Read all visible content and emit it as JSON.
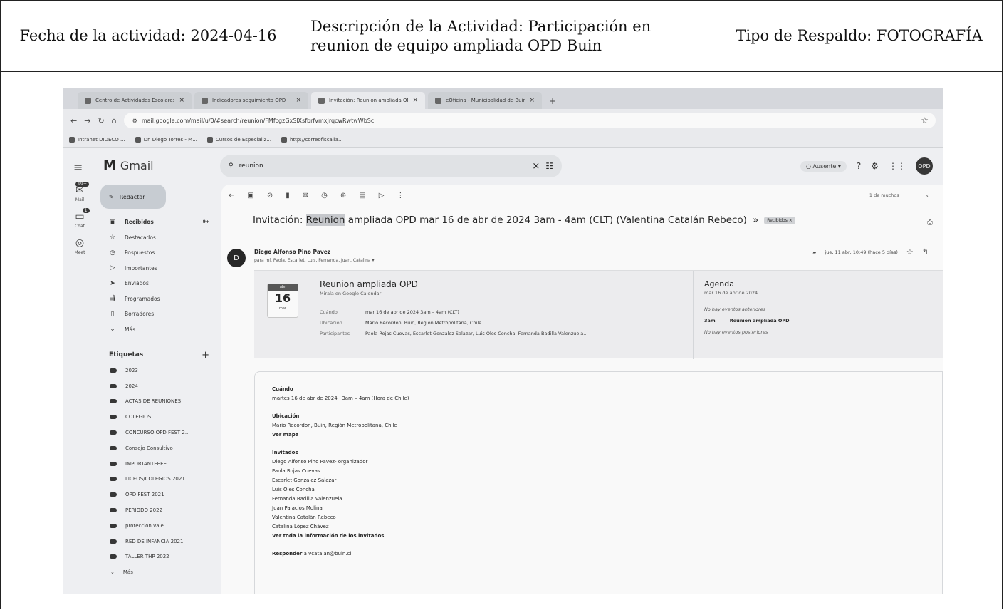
{
  "header": {
    "fecha": "Fecha de la actividad: 2024-04-16",
    "descripcion_l1": "Descripción de la Actividad: Participación en",
    "descripcion_l2": "reunion de equipo ampliada OPD Buin",
    "tipo": "Tipo de Respaldo: FOTOGRAFÍA"
  },
  "browser": {
    "tabs": [
      {
        "label": "Centro de Actividades Escolares",
        "active": false
      },
      {
        "label": "Indicadores seguimiento OPD",
        "active": false
      },
      {
        "label": "Invitación: Reunion ampliada OPD",
        "active": true
      },
      {
        "label": "eOficina - Municipalidad de Buin",
        "active": false
      }
    ],
    "new_tab": "+",
    "url": "mail.google.com/mail/u/0/#search/reunion/FMfcgzGxSlXsfbrfvmxJrqcwRwtwWbSc",
    "bookmarks": [
      "Intranet DIDECO ...",
      "Dr. Diego Torres - M...",
      "Cursos de Especializ...",
      "http://correofiscalia..."
    ]
  },
  "gmail": {
    "logo": "Gmail",
    "search_value": "reunion",
    "status": "Ausente",
    "avatar": "OPD",
    "rail": [
      {
        "label": "Mail",
        "badge": "99+"
      },
      {
        "label": "Chat",
        "badge": "1"
      },
      {
        "label": "Meet",
        "badge": ""
      }
    ],
    "compose": "Redactar",
    "nav": [
      {
        "label": "Recibidos",
        "count": "9+",
        "icon": "▣",
        "selected": true
      },
      {
        "label": "Destacados",
        "count": "",
        "icon": "☆",
        "selected": false
      },
      {
        "label": "Pospuestos",
        "count": "",
        "icon": "◷",
        "selected": false
      },
      {
        "label": "Importantes",
        "count": "",
        "icon": "▷",
        "selected": false
      },
      {
        "label": "Enviados",
        "count": "",
        "icon": "➤",
        "selected": false
      },
      {
        "label": "Programados",
        "count": "",
        "icon": "⇶",
        "selected": false
      },
      {
        "label": "Borradores",
        "count": "",
        "icon": "▯",
        "selected": false
      },
      {
        "label": "Más",
        "count": "",
        "icon": "⌄",
        "selected": false
      }
    ],
    "labels_header": "Etiquetas",
    "labels": [
      "2023",
      "2024",
      "ACTAS DE REUNIONES",
      "COLEGIOS",
      "CONCURSO OPD FEST 2...",
      "Consejo Consultivo",
      "IMPORTANTEEEE",
      "LICEOS/COLEGIOS 2021",
      "OPD FEST 2021",
      "PERIODO 2022",
      "proteccion vale",
      "RED DE INFANCIA 2021",
      "TALLER THP 2022",
      "Más"
    ],
    "pager": "1 de muchos",
    "subject_pre": "Invitación: ",
    "subject_hl": "Reunion",
    "subject_post": " ampliada OPD mar 16 de abr de 2024 3am - 4am (CLT) (Valentina Catalán Rebeco)",
    "subject_label": "Recibidos ×",
    "sender_initial": "D",
    "sender": "Diego Alfonso Pino Pavez",
    "recipients": "para mí, Paola, Escarlet, Luis, Fernanda, Juan, Catalina ▾",
    "date": "jue, 11 abr, 10:49 (hace 5 días)",
    "invite": {
      "month": "abr",
      "day": "16",
      "dow": "mar",
      "title": "Reunion ampliada OPD",
      "subtitle": "Mirala en Google Calendar",
      "rows": [
        {
          "k": "Cuándo",
          "v": "mar 16 de abr de 2024 3am – 4am (CLT)"
        },
        {
          "k": "Ubicación",
          "v": "Mario Recordon, Buin, Región Metropolitana, Chile"
        },
        {
          "k": "Participantes",
          "v": "Paola Rojas Cuevas, Escarlet Gonzalez Salazar, Luis Oles Concha, Fernanda Badilla Valenzuela..."
        }
      ],
      "agenda_title": "Agenda",
      "agenda_date": "mar 16 de abr de 2024",
      "agenda_before": "No hay eventos anteriores",
      "agenda_time": "3am",
      "agenda_event": "Reunion ampliada OPD",
      "agenda_after": "No hay eventos posteriores"
    },
    "body": {
      "cuando_h": "Cuándo",
      "cuando": "martes 16 de abr de 2024 · 3am – 4am (Hora de Chile)",
      "ubic_h": "Ubicación",
      "ubic": "Mario Recordon, Buin, Región Metropolitana, Chile",
      "ver_mapa": "Ver mapa",
      "inv_h": "Invitados",
      "invitados": [
        "Diego Alfonso Pino Pavez- organizador",
        "Paola Rojas Cuevas",
        "Escarlet Gonzalez Salazar",
        "Luis Oles Concha",
        "Fernanda Badilla Valenzuela",
        "Juan Palacios Molina",
        "Valentina Catalán Rebeco",
        "Catalina López Chávez"
      ],
      "ver_todo": "Ver toda la información de los invitados",
      "responder_h": "Responder",
      "responder": "a vcatalan@buin.cl"
    }
  }
}
